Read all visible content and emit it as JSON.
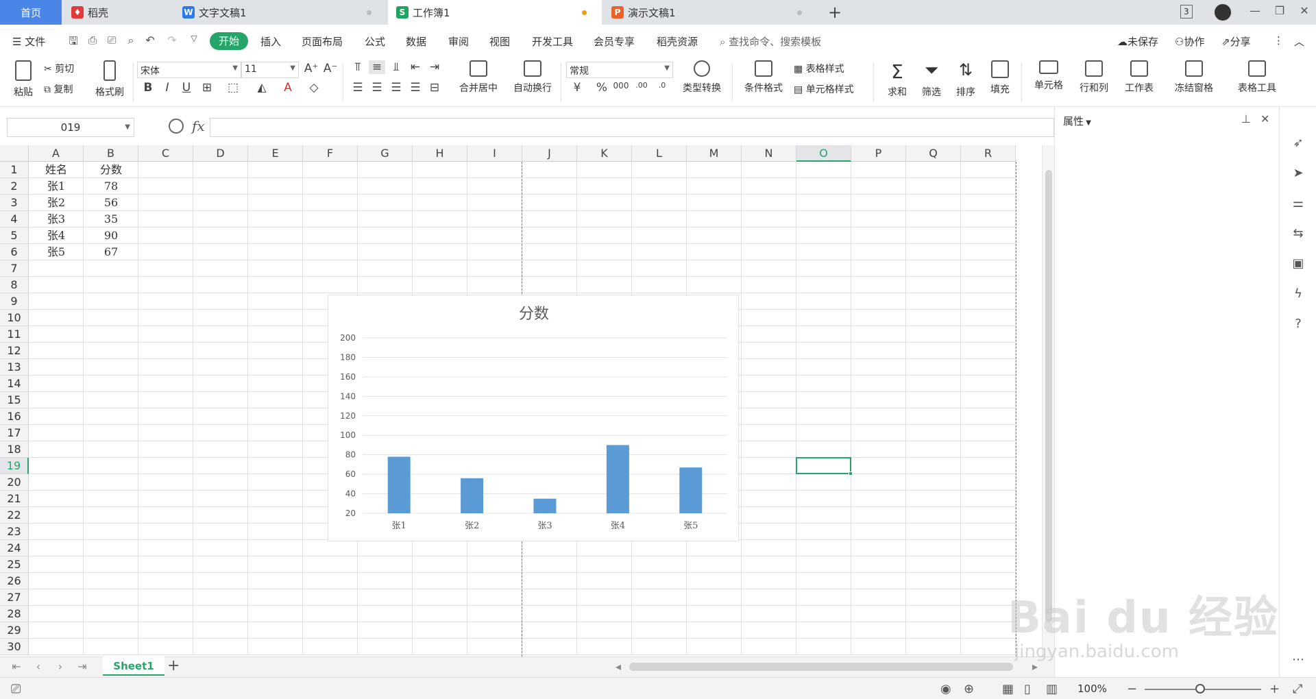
{
  "tabs": {
    "home": "首页",
    "items": [
      {
        "label": "稻壳",
        "icon": "daoke-icon",
        "color": "#e03a3a",
        "glyph": "W"
      },
      {
        "label": "文字文稿1",
        "icon": "writer-icon",
        "color": "#2b7ae5",
        "glyph": "W"
      },
      {
        "label": "工作簿1",
        "icon": "sheet-icon",
        "color": "#1fa463",
        "glyph": "S"
      },
      {
        "label": "演示文稿1",
        "icon": "slides-icon",
        "color": "#e8622c",
        "glyph": "P"
      }
    ],
    "window_count": "3"
  },
  "menu": {
    "file": "文件",
    "active": "开始",
    "items": [
      "插入",
      "页面布局",
      "公式",
      "数据",
      "审阅",
      "视图",
      "开发工具",
      "会员专享",
      "稻壳资源"
    ],
    "search_placeholder": "查找命令、搜索模板",
    "unsaved": "未保存",
    "collab": "协作",
    "share": "分享"
  },
  "ribbon": {
    "paste": "粘贴",
    "cut": "剪切",
    "copy": "复制",
    "format_painter": "格式刷",
    "font_name": "宋体",
    "font_size": "11",
    "number_format": "常规",
    "merge": "合并居中",
    "wrap": "自动换行",
    "type_convert": "类型转换",
    "cond_format": "条件格式",
    "table_style": "表格样式",
    "cell_style": "单元格样式",
    "sum": "求和",
    "filter": "筛选",
    "sort": "排序",
    "fill": "填充",
    "cell": "单元格",
    "row_col": "行和列",
    "worksheet": "工作表",
    "freeze": "冻结窗格",
    "table_tools": "表格工具"
  },
  "formula": {
    "name_box": "019",
    "fx": "fx",
    "value": ""
  },
  "grid": {
    "columns": [
      "A",
      "B",
      "C",
      "D",
      "E",
      "F",
      "G",
      "H",
      "I",
      "J",
      "K",
      "L",
      "M",
      "N",
      "O",
      "P",
      "Q",
      "R"
    ],
    "selected_column": "O",
    "selected_row": "19",
    "cells": [
      [
        "姓名",
        "分数"
      ],
      [
        "张1",
        "78"
      ],
      [
        "张2",
        "56"
      ],
      [
        "张3",
        "35"
      ],
      [
        "张4",
        "90"
      ],
      [
        "张5",
        "67"
      ]
    ]
  },
  "chart_data": {
    "type": "bar",
    "title": "分数",
    "categories": [
      "张1",
      "张2",
      "张3",
      "张4",
      "张5"
    ],
    "values": [
      78,
      56,
      35,
      90,
      67
    ],
    "yticks": [
      20,
      40,
      60,
      80,
      100,
      120,
      140,
      160,
      180,
      200
    ],
    "ylim": [
      20,
      200
    ],
    "grid": true,
    "color": "#5b9bd5",
    "xlabel": "",
    "ylabel": ""
  },
  "pane": {
    "title": "属性"
  },
  "sheets": {
    "active": "Sheet1"
  },
  "status": {
    "zoom": "100%"
  },
  "watermark": {
    "main": "Bai du 经验",
    "sub": "jingyan.baidu.com"
  }
}
